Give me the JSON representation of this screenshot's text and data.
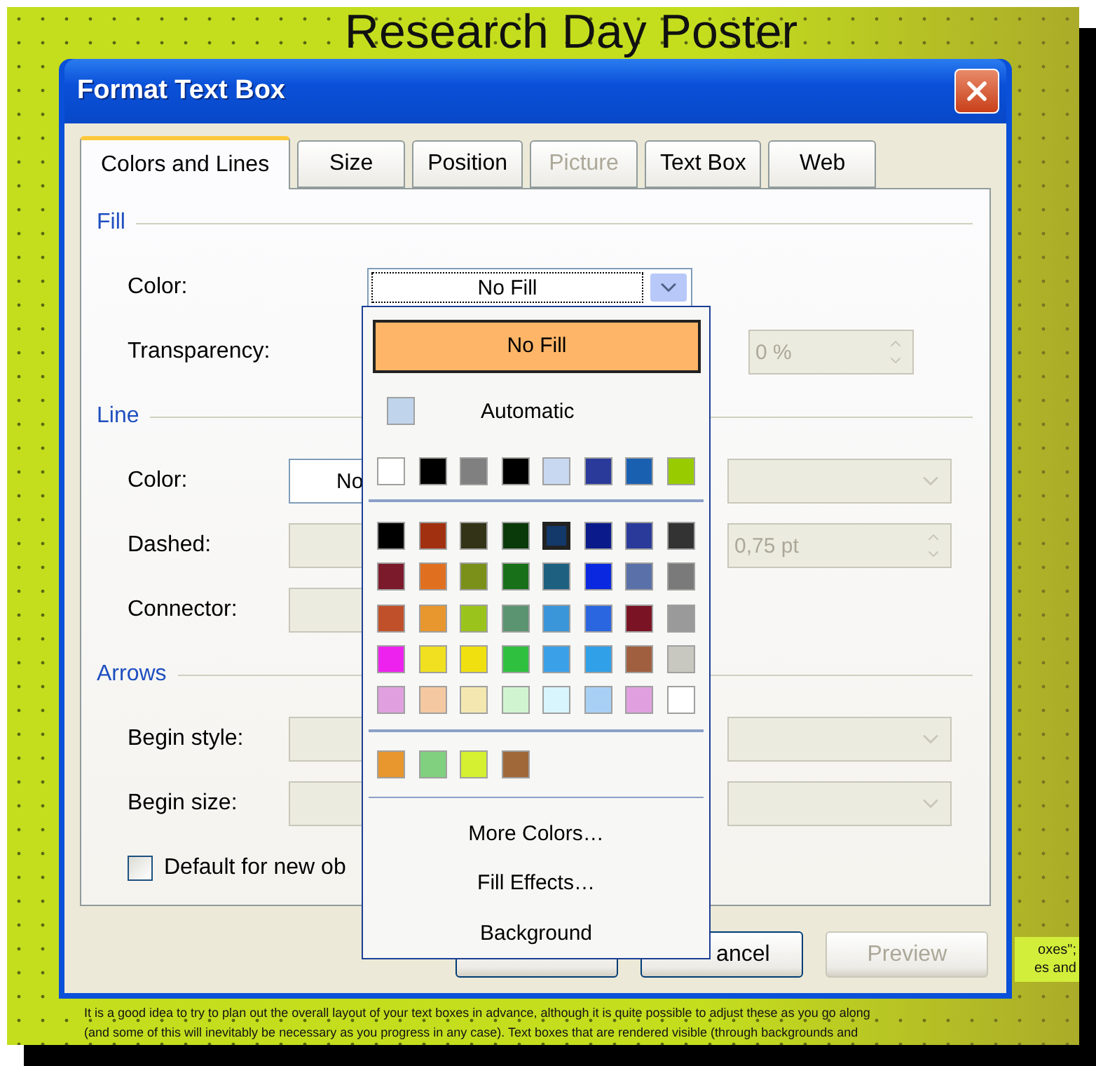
{
  "poster": {
    "title": "Research Day Poster",
    "side_text": [
      "oxes\";",
      "es and"
    ],
    "body_text": [
      "It is a good idea to try to plan out the overall layout of your text boxes in advance, although it is quite possible to adjust these as you go along",
      "(and some of this will inevitably be necessary as you progress in any case). Text boxes that are rendered visible (through backgrounds and"
    ]
  },
  "dialog": {
    "title": "Format Text Box",
    "tabs": [
      {
        "label": "Colors and Lines",
        "selected": true,
        "disabled": false
      },
      {
        "label": "Size",
        "selected": false,
        "disabled": false
      },
      {
        "label": "Position",
        "selected": false,
        "disabled": false
      },
      {
        "label": "Picture",
        "selected": false,
        "disabled": true
      },
      {
        "label": "Text Box",
        "selected": false,
        "disabled": false
      },
      {
        "label": "Web",
        "selected": false,
        "disabled": false
      }
    ],
    "sections": [
      {
        "title": "Fill",
        "rows": [
          {
            "label": "Color:",
            "left": {
              "kind": "combo",
              "value": "No Fill",
              "disabled": false
            }
          },
          {
            "label": "Transparency:",
            "right": {
              "kind": "spin",
              "value": "0 %",
              "disabled": true
            }
          }
        ]
      },
      {
        "title": "Line",
        "rows": [
          {
            "label": "Color:",
            "left": {
              "kind": "field",
              "value": "No",
              "disabled": false
            },
            "right": {
              "kind": "dropdown",
              "disabled": true
            }
          },
          {
            "label": "Dashed:",
            "left": {
              "kind": "dropdown",
              "disabled": true
            },
            "right": {
              "kind": "spin",
              "value": "0,75 pt",
              "disabled": true
            }
          },
          {
            "label": "Connector:",
            "left": {
              "kind": "dropdown",
              "disabled": true
            }
          }
        ]
      },
      {
        "title": "Arrows",
        "rows": [
          {
            "label": "Begin style:",
            "left": {
              "kind": "dropdown",
              "disabled": true
            },
            "right": {
              "kind": "dropdown",
              "disabled": true
            }
          },
          {
            "label": "Begin size:",
            "left": {
              "kind": "dropdown",
              "disabled": true
            },
            "right": {
              "kind": "dropdown",
              "disabled": true
            }
          }
        ]
      }
    ],
    "checkbox": {
      "label": "Default for new ob",
      "checked": false
    },
    "buttons": [
      {
        "disabled": false
      },
      {
        "label": "ancel",
        "disabled": false
      },
      {
        "label": "Preview",
        "disabled": true
      }
    ],
    "palette": {
      "no_fill": "No Fill",
      "automatic": {
        "label": "Automatic",
        "color": "#c0d4ec"
      },
      "recent": [
        {
          "color": "#ffffff"
        },
        {
          "color": "#000000"
        },
        {
          "color": "#808080"
        },
        {
          "color": "#000000"
        },
        {
          "color": "#c8d8f0"
        },
        {
          "color": "#2a3a9a"
        },
        {
          "color": "#1a60b0"
        },
        {
          "color": "#99cc00"
        }
      ],
      "rows": [
        {
          "swatches": [
            {
              "color": "#000000",
              "selected": false
            },
            {
              "color": "#a03010",
              "selected": false
            },
            {
              "color": "#333318",
              "selected": false
            },
            {
              "color": "#0a3a0a",
              "selected": false
            },
            {
              "color": "#13386a",
              "selected": true
            },
            {
              "color": "#0a1a8a",
              "selected": false
            },
            {
              "color": "#2a3a9a",
              "selected": false
            },
            {
              "color": "#333333",
              "selected": false
            }
          ]
        },
        {
          "swatches": [
            {
              "color": "#7a1a2a",
              "selected": false
            },
            {
              "color": "#e07020",
              "selected": false
            },
            {
              "color": "#7a9018",
              "selected": false
            },
            {
              "color": "#187018",
              "selected": false
            },
            {
              "color": "#1e6080",
              "selected": false
            },
            {
              "color": "#0a28e0",
              "selected": false
            },
            {
              "color": "#5a70a8",
              "selected": false
            },
            {
              "color": "#7a7a7a",
              "selected": false
            }
          ]
        },
        {
          "swatches": [
            {
              "color": "#c0502a",
              "selected": false
            },
            {
              "color": "#e8962e",
              "selected": false
            },
            {
              "color": "#9ac41c",
              "selected": false
            },
            {
              "color": "#5a9470",
              "selected": false
            },
            {
              "color": "#3a96d8",
              "selected": false
            },
            {
              "color": "#2a66e0",
              "selected": false
            },
            {
              "color": "#7a1424",
              "selected": false
            },
            {
              "color": "#9a9a9a",
              "selected": false
            }
          ]
        },
        {
          "swatches": [
            {
              "color": "#ee22ee",
              "selected": false
            },
            {
              "color": "#f0e020",
              "selected": false
            },
            {
              "color": "#f0e010",
              "selected": false
            },
            {
              "color": "#30c040",
              "selected": false
            },
            {
              "color": "#3aa0e8",
              "selected": false
            },
            {
              "color": "#30a0e8",
              "selected": false
            },
            {
              "color": "#a06040",
              "selected": false
            },
            {
              "color": "#c8c8c0",
              "selected": false
            }
          ]
        },
        {
          "swatches": [
            {
              "color": "#e0a0e0",
              "selected": false
            },
            {
              "color": "#f4c8a0",
              "selected": false
            },
            {
              "color": "#f4e8b0",
              "selected": false
            },
            {
              "color": "#d0f4d0",
              "selected": false
            },
            {
              "color": "#d8f4fc",
              "selected": false
            },
            {
              "color": "#a8d0f4",
              "selected": false
            },
            {
              "color": "#e0a0e0",
              "selected": false
            },
            {
              "color": "#ffffff",
              "selected": false
            }
          ]
        }
      ],
      "custom": [
        {
          "color": "#e8962e"
        },
        {
          "color": "#80d080"
        },
        {
          "color": "#d4f030"
        },
        {
          "color": "#a06838"
        }
      ],
      "menu": [
        "More Colors…",
        "Fill Effects…",
        "Background"
      ]
    }
  }
}
